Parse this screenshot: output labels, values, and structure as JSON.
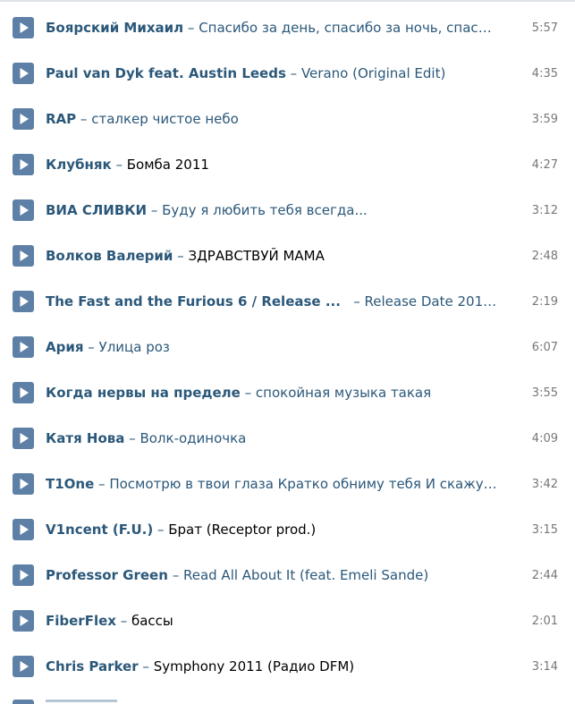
{
  "play_icon": "play-icon",
  "colors": {
    "play_button": "#5e80a6",
    "link": "#2b587a",
    "duration": "#777777"
  },
  "tracks": [
    {
      "artist": "Боярский Михаил",
      "sep": " – ",
      "title": "Спасибо за день, спасибо за ночь, спасибо за ...",
      "duration": "5:57"
    },
    {
      "artist": "Paul van Dyk feat. Austin Leeds",
      "sep": " – ",
      "title": "Verano (Original Edit)",
      "duration": "4:35"
    },
    {
      "artist": "RAP",
      "sep": " – ",
      "title": "сталкер чистое небо",
      "duration": "3:59"
    },
    {
      "artist": "Клубняк",
      "sep": " – ",
      "title": "Бомба 2011",
      "duration": "4:27"
    },
    {
      "artist": "ВИА СЛИВКИ",
      "sep": " – ",
      "title": "Буду я любить тебя всегда...",
      "duration": "3:12"
    },
    {
      "artist": "Волков Валерий",
      "sep": " – ",
      "title": "ЗДРАВСТВУЙ МАМА",
      "duration": "2:48"
    },
    {
      "artist": "The Fast and the Furious 6 / Release ...",
      "sep": "   – ",
      "title": "Release Date 2013 ...",
      "duration": "2:19"
    },
    {
      "artist": "Ария",
      "sep": " – ",
      "title": "Улица роз",
      "duration": "6:07"
    },
    {
      "artist": "Когда нервы на пределе",
      "sep": " – ",
      "title": "спокойная музыка такая",
      "duration": "3:55"
    },
    {
      "artist": "Катя Нова",
      "sep": " – ",
      "title": "Волк-одиночка",
      "duration": "4:09"
    },
    {
      "artist": "T1One",
      "sep": " – ",
      "title": "Посмотрю в твои глаза Кратко обниму тебя И скажу ...",
      "duration": "3:42"
    },
    {
      "artist": "V1ncent (F.U.)",
      "sep": " – ",
      "title": "Брат (Receptor prod.)",
      "duration": "3:15"
    },
    {
      "artist": "Professor Green",
      "sep": " – ",
      "title": "Read All About It (feat. Emeli Sande)",
      "duration": "2:44"
    },
    {
      "artist": "FiberFlex",
      "sep": " – ",
      "title": "бассы",
      "duration": "2:01"
    },
    {
      "artist": "Chris Parker",
      "sep": " – ",
      "title": "Symphony 2011 (Радио DFM)",
      "duration": "3:14"
    }
  ]
}
